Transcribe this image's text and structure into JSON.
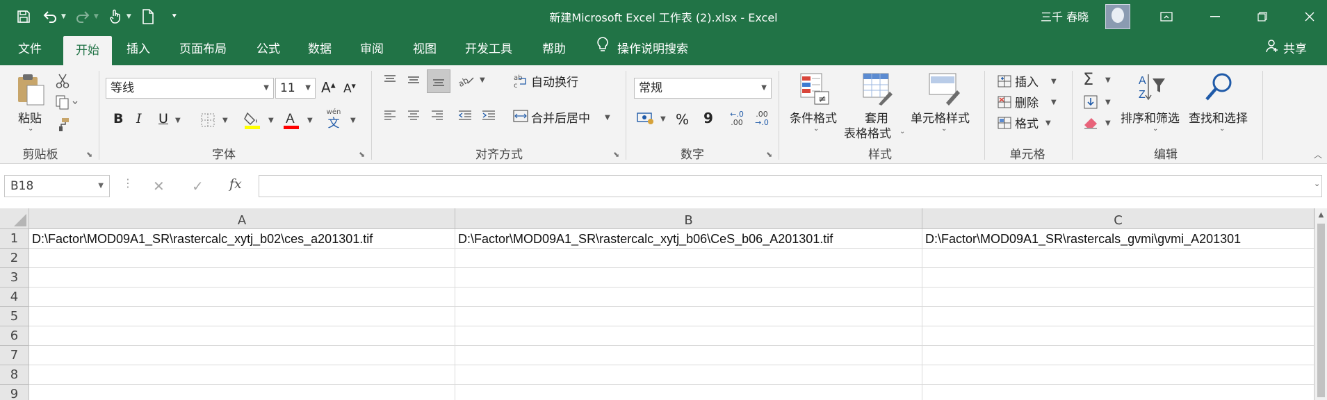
{
  "window": {
    "title": "新建Microsoft Excel 工作表 (2).xlsx  -  Excel",
    "user": "三千 春晓",
    "accent": "#217346"
  },
  "tabs": [
    "文件",
    "开始",
    "插入",
    "页面布局",
    "公式",
    "数据",
    "审阅",
    "视图",
    "开发工具",
    "帮助"
  ],
  "active_tab": "开始",
  "tell_me": "操作说明搜索",
  "share": "共享",
  "ribbon": {
    "clipboard": {
      "paste": "粘贴",
      "label": "剪贴板"
    },
    "font": {
      "name": "等线",
      "size": "11",
      "label": "字体",
      "bold": "B",
      "italic": "I",
      "underline": "U",
      "grow": "A",
      "shrink": "A",
      "phonetic_top": "wén",
      "phonetic_bottom": "文"
    },
    "alignment": {
      "wrap": "自动换行",
      "merge": "合并后居中",
      "label": "对齐方式"
    },
    "number": {
      "format": "常规",
      "label": "数字",
      "percent": "%",
      "comma": "9",
      "inc_decimal": ".00",
      "dec_decimal": ".0"
    },
    "styles": {
      "conditional": "条件格式",
      "table_line1": "套用",
      "table_line2": "表格格式",
      "cell_styles": "单元格样式",
      "label": "样式"
    },
    "cells": {
      "insert": "插入",
      "delete": "删除",
      "format": "格式",
      "label": "单元格"
    },
    "editing": {
      "sort_filter": "排序和筛选",
      "find_select": "查找和选择",
      "label": "编辑"
    }
  },
  "formula_bar": {
    "name_box": "B18",
    "fx": "fx",
    "content": ""
  },
  "grid": {
    "columns": [
      "A",
      "B",
      "C"
    ],
    "rows": [
      "1",
      "2",
      "3",
      "4",
      "5",
      "6",
      "7",
      "8",
      "9"
    ],
    "cells": {
      "A1": "D:\\Factor\\MOD09A1_SR\\rastercalc_xytj_b02\\ces_a201301.tif",
      "B1": "D:\\Factor\\MOD09A1_SR\\rastercalc_xytj_b06\\CeS_b06_A201301.tif",
      "C1": "D:\\Factor\\MOD09A1_SR\\rastercals_gvmi\\gvmi_A201301"
    }
  }
}
